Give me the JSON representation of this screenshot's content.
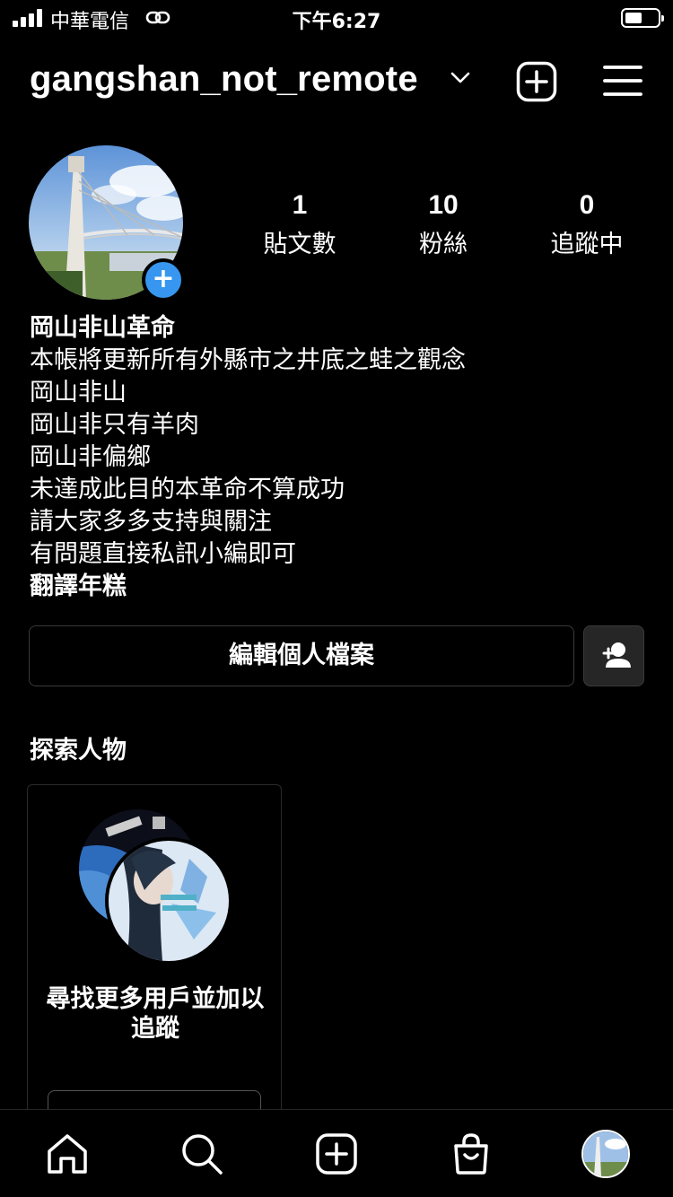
{
  "status_bar": {
    "carrier": "中華電信",
    "time": "下午6:27"
  },
  "header": {
    "username": "gangshan_not_remote"
  },
  "profile": {
    "stats": [
      {
        "value": "1",
        "label": "貼文數"
      },
      {
        "value": "10",
        "label": "粉絲"
      },
      {
        "value": "0",
        "label": "追蹤中"
      }
    ],
    "display_name": "岡山非山革命",
    "bio_lines": [
      "本帳將更新所有外縣市之井底之蛙之觀念",
      "岡山非山",
      "岡山非只有羊肉",
      "岡山非偏鄉",
      "未達成此目的本革命不算成功",
      "請大家多多支持與關注",
      "有問題直接私訊小編即可"
    ],
    "bio_signature": "翻譯年糕",
    "edit_button": "編輯個人檔案"
  },
  "discover": {
    "title": "探索人物",
    "card_text": "尋找更多用戶並加以追蹤"
  },
  "colors": {
    "accent": "#3797f0",
    "background": "#000000",
    "border": "#3a3a3a"
  },
  "icons": {
    "header": [
      "chevron-down-icon",
      "add-post-icon",
      "menu-icon"
    ],
    "bottom_nav": [
      "home-icon",
      "search-icon",
      "add-icon",
      "shop-icon",
      "profile-avatar"
    ]
  }
}
